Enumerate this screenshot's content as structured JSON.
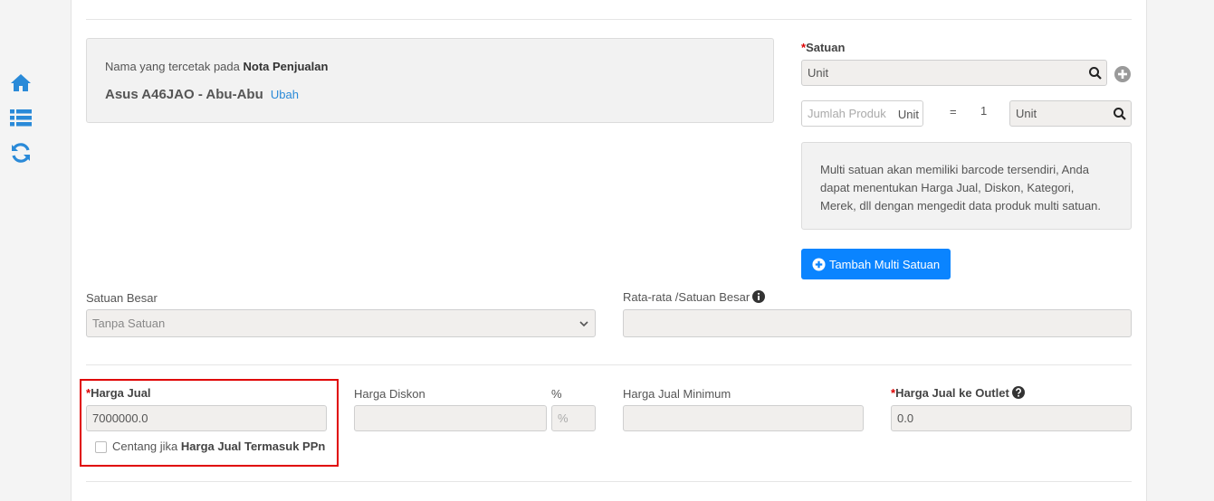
{
  "sidebar": {
    "icons": [
      "home-icon",
      "list-icon",
      "refresh-icon"
    ]
  },
  "name_box": {
    "prefix": "Nama yang tercetak pada ",
    "prefix_bold": "Nota Penjualan",
    "product_name": "Asus A46JAO - Abu-Abu",
    "edit_link": "Ubah"
  },
  "satuan": {
    "required_mark": "*",
    "label": "Satuan",
    "value": "Unit",
    "add_icon": "plus-circle-icon"
  },
  "conversion": {
    "qty_placeholder": "Jumlah Produk",
    "qty_unit": "Unit",
    "equals": "=",
    "base_qty": "1",
    "base_unit": "Unit"
  },
  "info_text": "Multi satuan akan memiliki barcode tersendiri, Anda dapat menentukan Harga Jual, Diskon, Kategori, Merek, dll dengan mengedit data produk multi satuan.",
  "add_multi_button": "Tambah Multi Satuan",
  "satuan_besar": {
    "label": "Satuan Besar",
    "selected": "Tanpa Satuan"
  },
  "rata_rata": {
    "label": "Rata-rata /Satuan Besar",
    "value": ""
  },
  "harga_jual": {
    "required_mark": "*",
    "label": "Harga Jual",
    "value": "7000000.0",
    "checkbox_prefix": "Centang jika ",
    "checkbox_bold": "Harga Jual Termasuk PPn",
    "checked": false
  },
  "harga_diskon": {
    "label": "Harga Diskon",
    "value": "",
    "percent_label": "%",
    "percent_placeholder": "%"
  },
  "harga_jual_minimum": {
    "label": "Harga Jual Minimum",
    "value": ""
  },
  "harga_jual_outlet": {
    "required_mark": "*",
    "label": "Harga Jual ke Outlet",
    "value": "0.0"
  },
  "colors": {
    "accent": "#2a8ad8",
    "primary_button": "#0a84ff",
    "highlight_border": "#e00000",
    "required": "#dd0000"
  }
}
